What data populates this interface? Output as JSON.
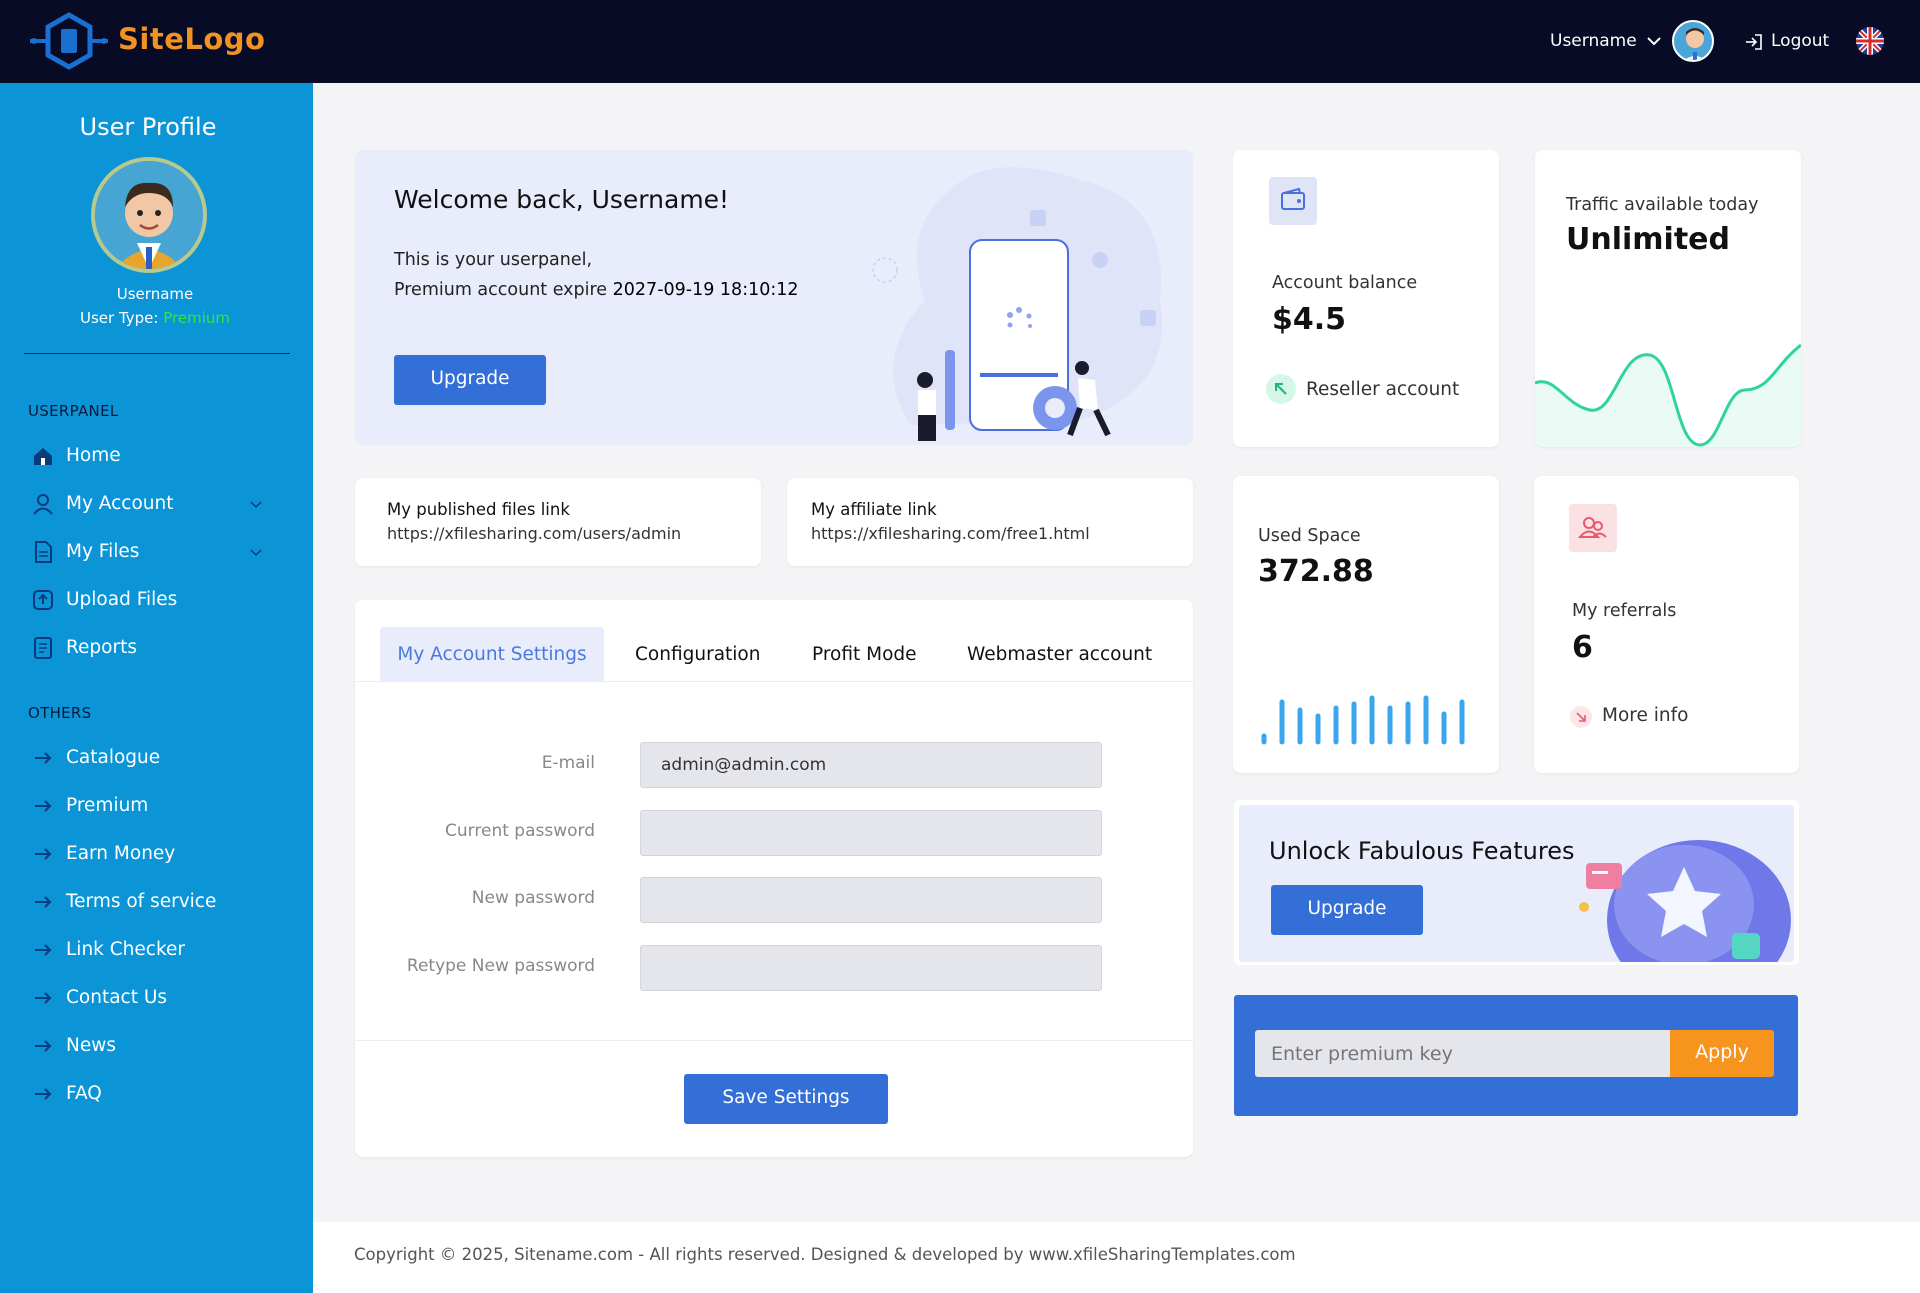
{
  "header": {
    "logo_text": "SiteLogo",
    "username": "Username",
    "logout_label": "Logout"
  },
  "sidebar": {
    "title": "User Profile",
    "username": "Username",
    "user_type_label": "User Type:",
    "user_type_value": "Premium",
    "section_userpanel": "USERPANEL",
    "section_others": "OTHERS",
    "userpanel_items": [
      {
        "label": "Home",
        "icon": "home-icon"
      },
      {
        "label": "My Account",
        "icon": "user-icon",
        "expandable": true
      },
      {
        "label": "My Files",
        "icon": "file-icon",
        "expandable": true
      },
      {
        "label": "Upload Files",
        "icon": "upload-icon"
      },
      {
        "label": "Reports",
        "icon": "report-icon"
      }
    ],
    "other_items": [
      {
        "label": "Catalogue",
        "icon": "arrow-right-icon"
      },
      {
        "label": "Premium",
        "icon": "arrow-right-icon"
      },
      {
        "label": "Earn Money",
        "icon": "arrow-right-icon"
      },
      {
        "label": "Terms of service",
        "icon": "arrow-right-icon"
      },
      {
        "label": "Link Checker",
        "icon": "arrow-right-icon"
      },
      {
        "label": "Contact Us",
        "icon": "arrow-right-icon"
      },
      {
        "label": "News",
        "icon": "arrow-right-icon"
      },
      {
        "label": "FAQ",
        "icon": "arrow-right-icon"
      }
    ]
  },
  "welcome": {
    "title": "Welcome back, Username!",
    "line1": "This is your userpanel,",
    "line2_prefix": "Premium account expire",
    "expire_date": "2027-09-19 18:10:12",
    "upgrade_label": "Upgrade"
  },
  "links": {
    "published_title": "My published files link",
    "published_url": "https://xfilesharing.com/users/admin",
    "affiliate_title": "My affiliate link",
    "affiliate_url": "https://xfilesharing.com/free1.html"
  },
  "settings": {
    "tabs": [
      "My Account Settings",
      "Configuration",
      "Profit Mode",
      "Webmaster account"
    ],
    "active_tab": "My Account Settings",
    "fields": [
      {
        "label": "E-mail",
        "value": "admin@admin.com"
      },
      {
        "label": "Current password",
        "value": ""
      },
      {
        "label": "New password",
        "value": ""
      },
      {
        "label": "Retype New password",
        "value": ""
      }
    ],
    "save_label": "Save Settings"
  },
  "stats": {
    "balance_label": "Account balance",
    "balance_value": "$4.5",
    "reseller_label": "Reseller account",
    "traffic_label": "Traffic available today",
    "traffic_value": "Unlimited",
    "used_space_label": "Used Space",
    "used_space_value": "372.88",
    "referrals_label": "My referrals",
    "referrals_value": "6",
    "more_info_label": "More info"
  },
  "unlock": {
    "title": "Unlock Fabulous Features",
    "upgrade_label": "Upgrade"
  },
  "premium_key": {
    "placeholder": "Enter premium key",
    "apply_label": "Apply"
  },
  "footer": {
    "text": "Copyright © 2025, Sitename.com - All rights reserved. Designed & developed by www.xfileSharingTemplates.com"
  },
  "colors": {
    "topbar": "#070b25",
    "sidebar": "#0b95d7",
    "accent_blue": "#336fd6",
    "logo_orange": "#f29321",
    "apply_orange": "#f7941e",
    "premium_green": "#2ee83a",
    "traffic_line": "#2ed3a0",
    "bars": "#3aa6ef"
  }
}
